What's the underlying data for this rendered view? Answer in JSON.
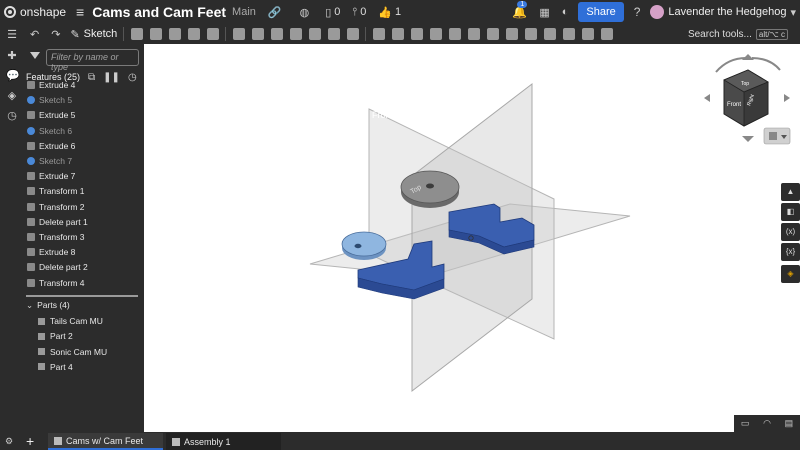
{
  "app": {
    "logo_text": "onshape"
  },
  "document": {
    "title": "Cams and Cam Feet",
    "branch": "Main"
  },
  "header": {
    "versions_count": "0",
    "branches_count": "0",
    "likes_count": "1",
    "notifications_badge": "1",
    "share_label": "Share",
    "help_icon": "?",
    "user_name": "Lavender the Hedgehog"
  },
  "toolbar": {
    "sketch_label": "Sketch",
    "search_label": "Search tools...",
    "search_shortcut": "alt/⌥ c"
  },
  "features": {
    "filter_placeholder": "Filter by name or type",
    "header_label": "Features (25)",
    "items": [
      {
        "label": "Extrude 4",
        "kind": "extrude"
      },
      {
        "label": "Sketch 5",
        "kind": "sketch"
      },
      {
        "label": "Extrude 5",
        "kind": "extrude"
      },
      {
        "label": "Sketch 6",
        "kind": "sketch"
      },
      {
        "label": "Extrude 6",
        "kind": "extrude"
      },
      {
        "label": "Sketch 7",
        "kind": "sketch"
      },
      {
        "label": "Extrude 7",
        "kind": "extrude"
      },
      {
        "label": "Transform 1",
        "kind": "transform"
      },
      {
        "label": "Transform 2",
        "kind": "transform"
      },
      {
        "label": "Delete part 1",
        "kind": "delete"
      },
      {
        "label": "Transform 3",
        "kind": "transform"
      },
      {
        "label": "Extrude 8",
        "kind": "extrude"
      },
      {
        "label": "Delete part 2",
        "kind": "delete"
      },
      {
        "label": "Transform 4",
        "kind": "transform"
      }
    ]
  },
  "parts": {
    "header_label": "Parts (4)",
    "items": [
      {
        "label": "Tails Cam MU"
      },
      {
        "label": "Part 2"
      },
      {
        "label": "Sonic Cam MU"
      },
      {
        "label": "Part 4"
      }
    ]
  },
  "viewport": {
    "plane_front_label": "Front",
    "plane_top_label": "Top",
    "view_cube_front": "Front",
    "view_cube_top": "Top",
    "view_cube_right": "Right",
    "colors": {
      "part_blue": "#3a5fb0",
      "cam_gray": "#8e8e8e",
      "cam_light_blue": "#8fb6e0",
      "plane_gray": "#c9c9c9"
    }
  },
  "tabs": [
    {
      "label": "Cams w/ Cam Feet",
      "active": true
    },
    {
      "label": "Assembly 1",
      "active": false
    }
  ],
  "icons": {
    "menu": "hamburger-icon",
    "undo": "undo-icon",
    "redo": "redo-icon",
    "filter": "filter-icon",
    "add_tab": "plus-icon"
  }
}
